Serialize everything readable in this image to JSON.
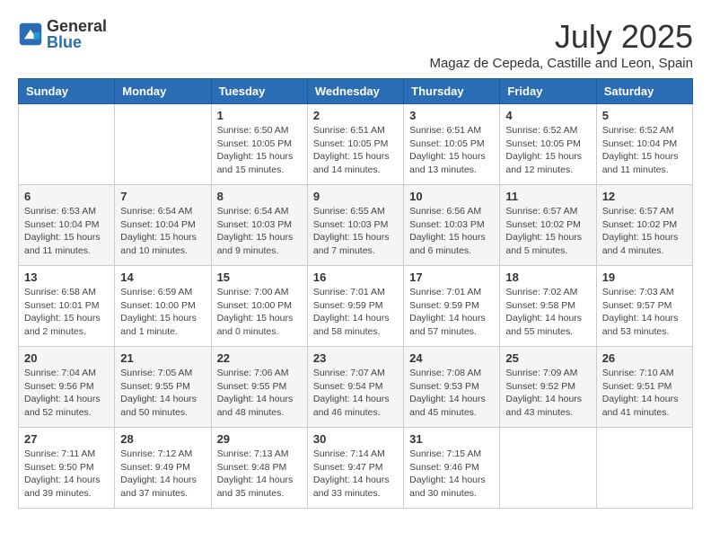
{
  "header": {
    "logo_general": "General",
    "logo_blue": "Blue",
    "month": "July 2025",
    "location": "Magaz de Cepeda, Castille and Leon, Spain"
  },
  "days_of_week": [
    "Sunday",
    "Monday",
    "Tuesday",
    "Wednesday",
    "Thursday",
    "Friday",
    "Saturday"
  ],
  "weeks": [
    [
      {
        "day": "",
        "info": ""
      },
      {
        "day": "",
        "info": ""
      },
      {
        "day": "1",
        "info": "Sunrise: 6:50 AM\nSunset: 10:05 PM\nDaylight: 15 hours\nand 15 minutes."
      },
      {
        "day": "2",
        "info": "Sunrise: 6:51 AM\nSunset: 10:05 PM\nDaylight: 15 hours\nand 14 minutes."
      },
      {
        "day": "3",
        "info": "Sunrise: 6:51 AM\nSunset: 10:05 PM\nDaylight: 15 hours\nand 13 minutes."
      },
      {
        "day": "4",
        "info": "Sunrise: 6:52 AM\nSunset: 10:05 PM\nDaylight: 15 hours\nand 12 minutes."
      },
      {
        "day": "5",
        "info": "Sunrise: 6:52 AM\nSunset: 10:04 PM\nDaylight: 15 hours\nand 11 minutes."
      }
    ],
    [
      {
        "day": "6",
        "info": "Sunrise: 6:53 AM\nSunset: 10:04 PM\nDaylight: 15 hours\nand 11 minutes."
      },
      {
        "day": "7",
        "info": "Sunrise: 6:54 AM\nSunset: 10:04 PM\nDaylight: 15 hours\nand 10 minutes."
      },
      {
        "day": "8",
        "info": "Sunrise: 6:54 AM\nSunset: 10:03 PM\nDaylight: 15 hours\nand 9 minutes."
      },
      {
        "day": "9",
        "info": "Sunrise: 6:55 AM\nSunset: 10:03 PM\nDaylight: 15 hours\nand 7 minutes."
      },
      {
        "day": "10",
        "info": "Sunrise: 6:56 AM\nSunset: 10:03 PM\nDaylight: 15 hours\nand 6 minutes."
      },
      {
        "day": "11",
        "info": "Sunrise: 6:57 AM\nSunset: 10:02 PM\nDaylight: 15 hours\nand 5 minutes."
      },
      {
        "day": "12",
        "info": "Sunrise: 6:57 AM\nSunset: 10:02 PM\nDaylight: 15 hours\nand 4 minutes."
      }
    ],
    [
      {
        "day": "13",
        "info": "Sunrise: 6:58 AM\nSunset: 10:01 PM\nDaylight: 15 hours\nand 2 minutes."
      },
      {
        "day": "14",
        "info": "Sunrise: 6:59 AM\nSunset: 10:00 PM\nDaylight: 15 hours\nand 1 minute."
      },
      {
        "day": "15",
        "info": "Sunrise: 7:00 AM\nSunset: 10:00 PM\nDaylight: 15 hours\nand 0 minutes."
      },
      {
        "day": "16",
        "info": "Sunrise: 7:01 AM\nSunset: 9:59 PM\nDaylight: 14 hours\nand 58 minutes."
      },
      {
        "day": "17",
        "info": "Sunrise: 7:01 AM\nSunset: 9:59 PM\nDaylight: 14 hours\nand 57 minutes."
      },
      {
        "day": "18",
        "info": "Sunrise: 7:02 AM\nSunset: 9:58 PM\nDaylight: 14 hours\nand 55 minutes."
      },
      {
        "day": "19",
        "info": "Sunrise: 7:03 AM\nSunset: 9:57 PM\nDaylight: 14 hours\nand 53 minutes."
      }
    ],
    [
      {
        "day": "20",
        "info": "Sunrise: 7:04 AM\nSunset: 9:56 PM\nDaylight: 14 hours\nand 52 minutes."
      },
      {
        "day": "21",
        "info": "Sunrise: 7:05 AM\nSunset: 9:55 PM\nDaylight: 14 hours\nand 50 minutes."
      },
      {
        "day": "22",
        "info": "Sunrise: 7:06 AM\nSunset: 9:55 PM\nDaylight: 14 hours\nand 48 minutes."
      },
      {
        "day": "23",
        "info": "Sunrise: 7:07 AM\nSunset: 9:54 PM\nDaylight: 14 hours\nand 46 minutes."
      },
      {
        "day": "24",
        "info": "Sunrise: 7:08 AM\nSunset: 9:53 PM\nDaylight: 14 hours\nand 45 minutes."
      },
      {
        "day": "25",
        "info": "Sunrise: 7:09 AM\nSunset: 9:52 PM\nDaylight: 14 hours\nand 43 minutes."
      },
      {
        "day": "26",
        "info": "Sunrise: 7:10 AM\nSunset: 9:51 PM\nDaylight: 14 hours\nand 41 minutes."
      }
    ],
    [
      {
        "day": "27",
        "info": "Sunrise: 7:11 AM\nSunset: 9:50 PM\nDaylight: 14 hours\nand 39 minutes."
      },
      {
        "day": "28",
        "info": "Sunrise: 7:12 AM\nSunset: 9:49 PM\nDaylight: 14 hours\nand 37 minutes."
      },
      {
        "day": "29",
        "info": "Sunrise: 7:13 AM\nSunset: 9:48 PM\nDaylight: 14 hours\nand 35 minutes."
      },
      {
        "day": "30",
        "info": "Sunrise: 7:14 AM\nSunset: 9:47 PM\nDaylight: 14 hours\nand 33 minutes."
      },
      {
        "day": "31",
        "info": "Sunrise: 7:15 AM\nSunset: 9:46 PM\nDaylight: 14 hours\nand 30 minutes."
      },
      {
        "day": "",
        "info": ""
      },
      {
        "day": "",
        "info": ""
      }
    ]
  ]
}
